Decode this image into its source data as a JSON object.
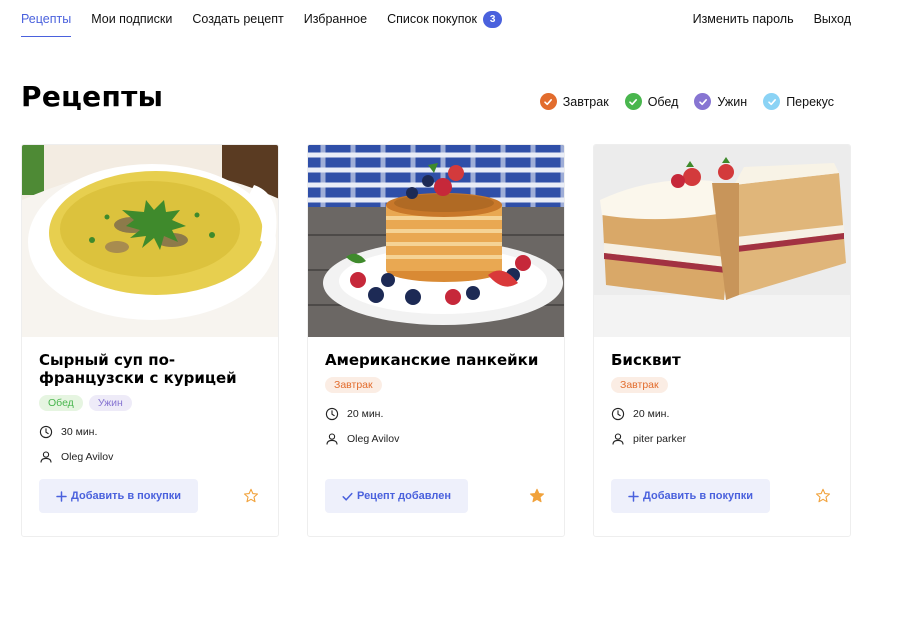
{
  "nav": {
    "items": [
      {
        "label": "Рецепты",
        "active": true
      },
      {
        "label": "Мои подписки"
      },
      {
        "label": "Создать рецепт"
      },
      {
        "label": "Избранное"
      },
      {
        "label": "Список покупок",
        "badge": "3"
      }
    ],
    "right": [
      {
        "label": "Изменить пароль"
      },
      {
        "label": "Выход"
      }
    ]
  },
  "page": {
    "title": "Рецепты"
  },
  "filters": [
    {
      "label": "Завтрак",
      "color": "#e26c2d",
      "checked": true
    },
    {
      "label": "Обед",
      "color": "#49b64e",
      "checked": true
    },
    {
      "label": "Ужин",
      "color": "#8775d2",
      "checked": true
    },
    {
      "label": "Перекус",
      "color": "#8bd3f5",
      "checked": true
    }
  ],
  "recipes": [
    {
      "title": "Сырный суп по-французски с курицей",
      "tags": [
        {
          "label": "Обед",
          "kind": "lunch"
        },
        {
          "label": "Ужин",
          "kind": "dinner"
        }
      ],
      "time": "30 мин.",
      "author": "Oleg Avilov",
      "button": "Добавить в покупки",
      "added": false,
      "favorite": false
    },
    {
      "title": "Американские панкейки",
      "tags": [
        {
          "label": "Завтрак",
          "kind": "breakfast"
        }
      ],
      "time": "20 мин.",
      "author": "Oleg Avilov",
      "button": "Рецепт добавлен",
      "added": true,
      "favorite": true
    },
    {
      "title": "Бисквит",
      "tags": [
        {
          "label": "Завтрак",
          "kind": "breakfast"
        }
      ],
      "time": "20 мин.",
      "author": "piter parker",
      "button": "Добавить в покупки",
      "added": false,
      "favorite": false
    }
  ],
  "colors": {
    "accent": "#4a61dd",
    "star": "#f1a23b"
  }
}
